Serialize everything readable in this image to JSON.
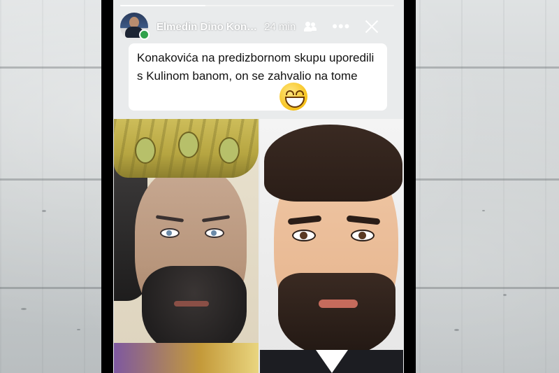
{
  "story": {
    "progress": 0.31,
    "author": {
      "name": "Elmedin Dino Kon…",
      "online": true
    },
    "time_ago": "24 min",
    "icons": {
      "audience": "friends-icon",
      "more": "more-options-icon",
      "close": "close-icon",
      "emoji": "grinning-face-emoji"
    },
    "caption": "Konakovića na predizbornom skupu uporedili s Kulinom banom, on se zahvalio na tome",
    "colors": {
      "online": "#31a24c",
      "caption_bg": "#ffffff",
      "frame": "#000000"
    }
  }
}
